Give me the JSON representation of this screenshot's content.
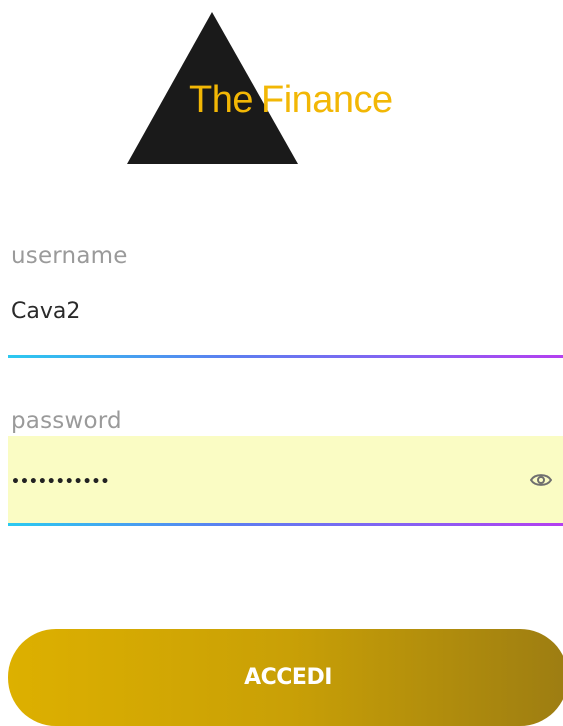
{
  "logo": {
    "word_the": "The",
    "word_finance": "Finance"
  },
  "login_form": {
    "username": {
      "label": "username",
      "value": "Cava2"
    },
    "password": {
      "label": "password",
      "value_masked": "•••••••••••"
    },
    "submit_label": "ACCEDI"
  },
  "icons": {
    "password_toggle": "eye-icon"
  },
  "colors": {
    "logo_triangle": "#1a1a1a",
    "logo_text": "#f2b705",
    "underline_start": "#2bc9f0",
    "underline_end": "#b43ff0",
    "autofill_background": "#fafcc4",
    "button_start": "#ddb000",
    "button_end": "#9d7d12"
  }
}
